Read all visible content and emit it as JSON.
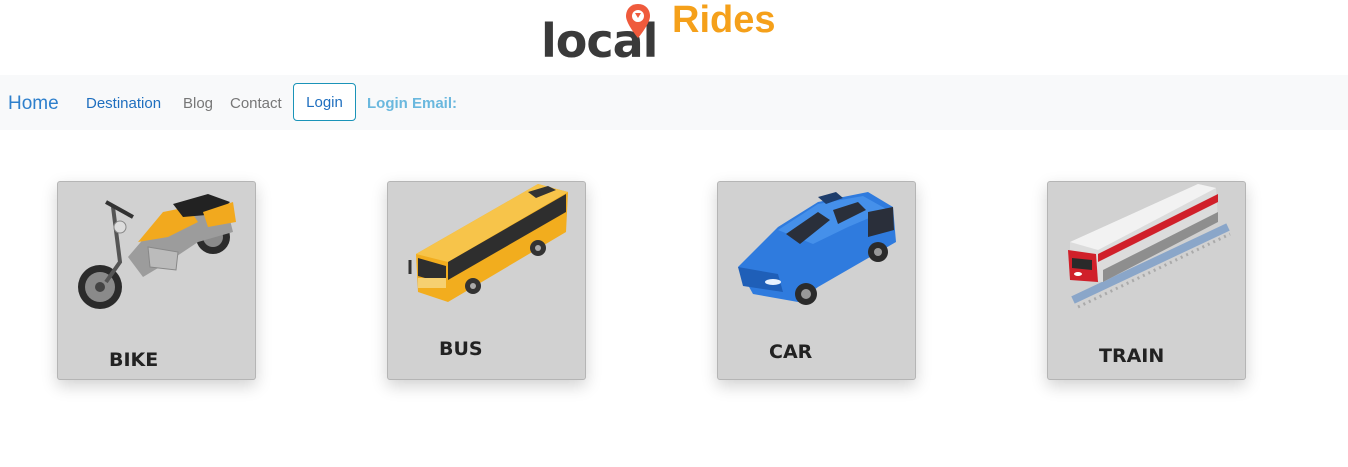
{
  "brand": {
    "logo_text": "local",
    "title": "Rides",
    "pin_icon": "location-pin-icon"
  },
  "nav": {
    "home": "Home",
    "links": [
      "Destination",
      "Blog",
      "Contact"
    ],
    "login_button": "Login",
    "login_email_label": "Login Email:"
  },
  "vehicles": [
    {
      "label": "BIKE",
      "icon": "motorcycle-icon"
    },
    {
      "label": "BUS",
      "icon": "bus-icon"
    },
    {
      "label": "CAR",
      "icon": "car-icon"
    },
    {
      "label": "TRAIN",
      "icon": "train-icon"
    }
  ],
  "colors": {
    "brand_orange": "#f5a01a",
    "link_blue": "#1f6fbf",
    "card_bg": "#d1d1d1",
    "nav_bg": "#f8f9fa"
  }
}
